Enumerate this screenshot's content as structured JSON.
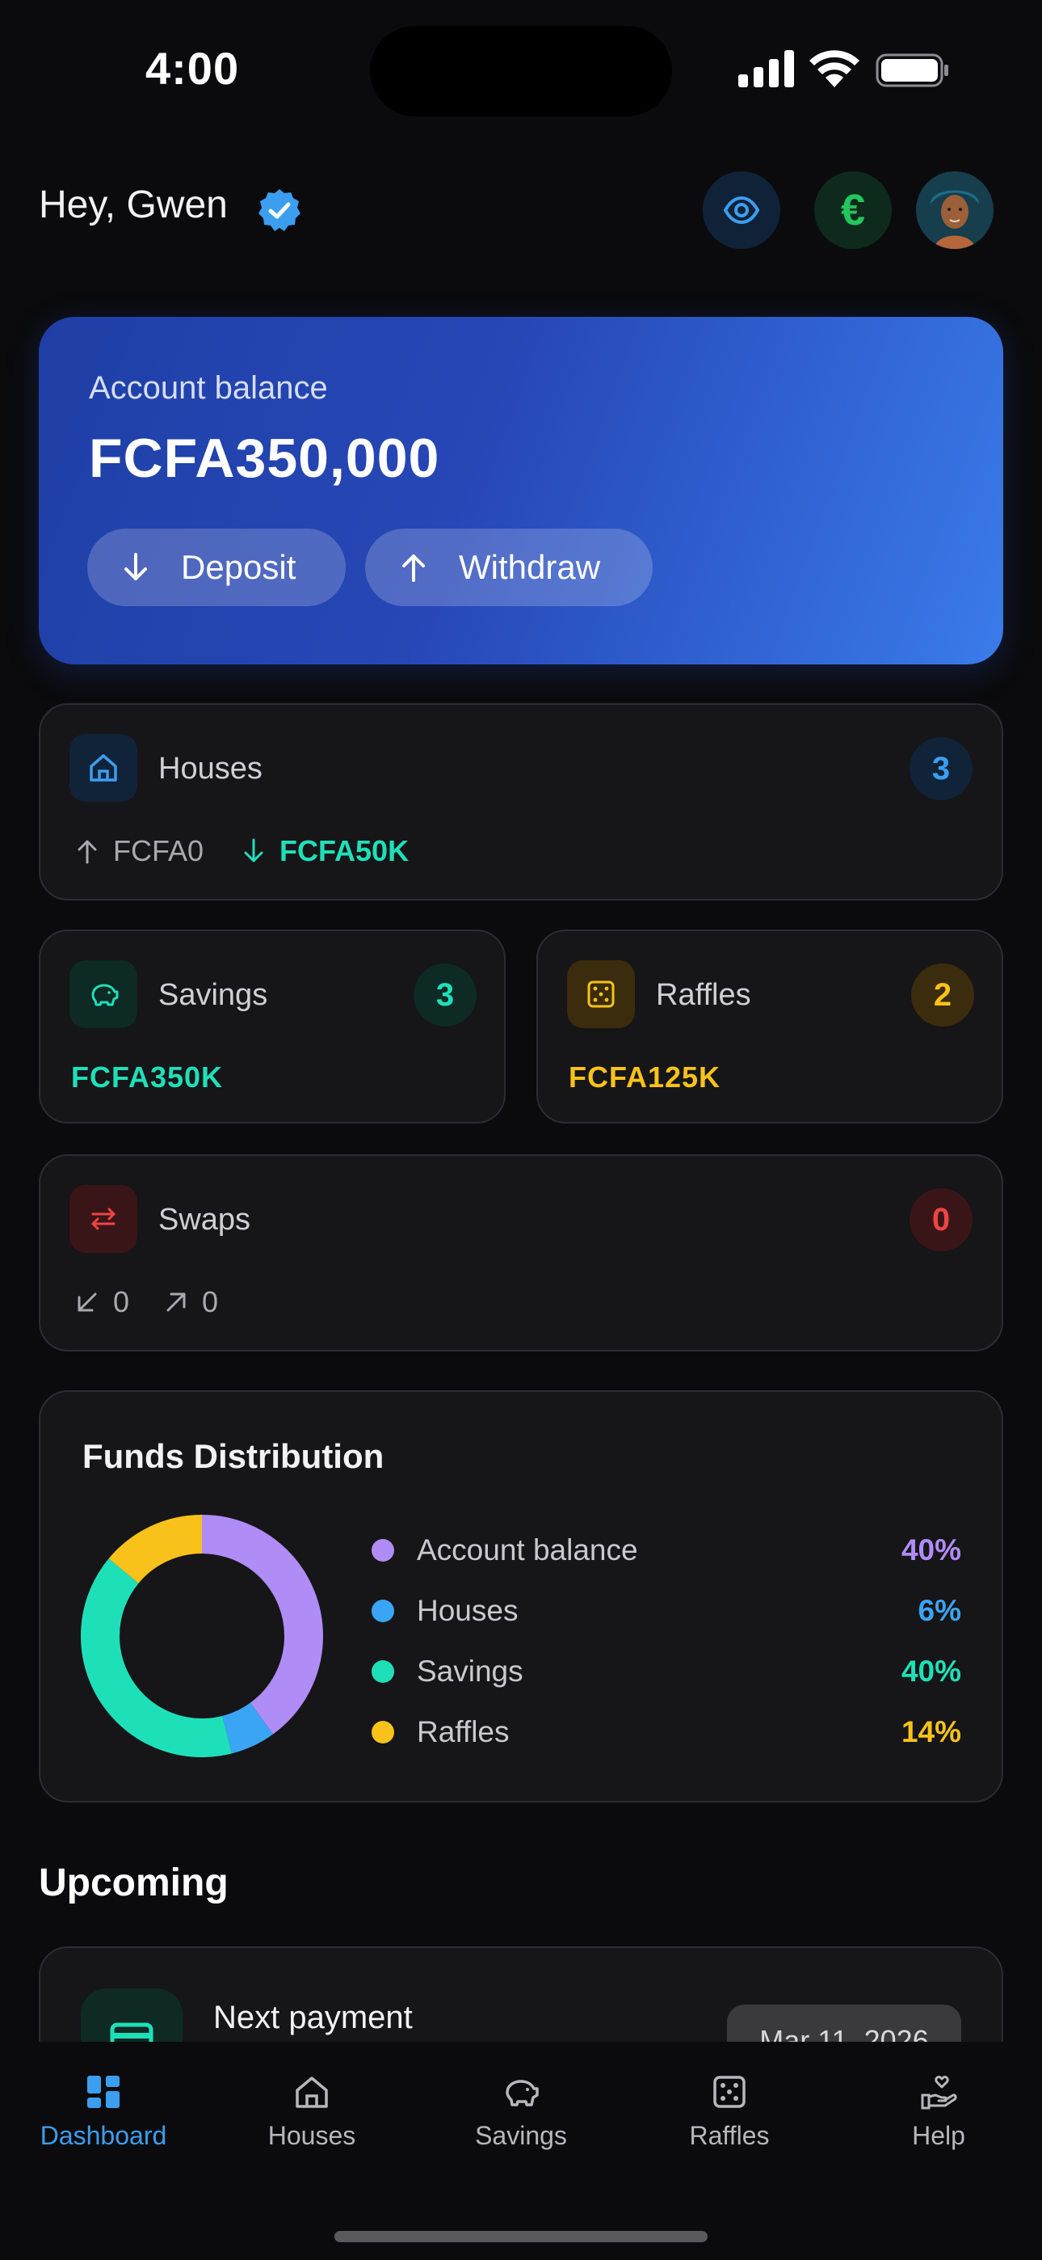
{
  "status": {
    "time": "4:00"
  },
  "header": {
    "greeting": "Hey, Gwen",
    "euro_symbol": "€"
  },
  "balance": {
    "label": "Account balance",
    "amount": "FCFA350,000",
    "deposit_label": "Deposit",
    "withdraw_label": "Withdraw"
  },
  "houses": {
    "title": "Houses",
    "count": "3",
    "out_amount": "FCFA0",
    "in_amount": "FCFA50K"
  },
  "savings": {
    "title": "Savings",
    "count": "3",
    "amount": "FCFA350K"
  },
  "raffles": {
    "title": "Raffles",
    "count": "2",
    "amount": "FCFA125K"
  },
  "swaps": {
    "title": "Swaps",
    "count": "0",
    "incoming": "0",
    "outgoing": "0"
  },
  "distribution": {
    "title": "Funds Distribution",
    "items": [
      {
        "label": "Account balance",
        "pct": "40%",
        "value": 40,
        "color": "#b08cf7"
      },
      {
        "label": "Houses",
        "pct": "6%",
        "value": 6,
        "color": "#3aa5f5"
      },
      {
        "label": "Savings",
        "pct": "40%",
        "value": 40,
        "color": "#1ee0b8"
      },
      {
        "label": "Raffles",
        "pct": "14%",
        "value": 14,
        "color": "#f8c21a"
      }
    ]
  },
  "upcoming": {
    "title": "Upcoming",
    "next_payment_label": "Next payment",
    "date": "Mar 11, 2026"
  },
  "tabs": [
    {
      "label": "Dashboard",
      "icon": "dashboard-icon",
      "active": true
    },
    {
      "label": "Houses",
      "icon": "home-icon",
      "active": false
    },
    {
      "label": "Savings",
      "icon": "piggy-bank-icon",
      "active": false
    },
    {
      "label": "Raffles",
      "icon": "dice-icon",
      "active": false
    },
    {
      "label": "Help",
      "icon": "hand-heart-icon",
      "active": false
    }
  ],
  "colors": {
    "accent": "#3b9eef",
    "teal": "#1ee0b8",
    "yellow": "#f8c21a",
    "red": "#ef4444",
    "purple": "#b08cf7"
  }
}
